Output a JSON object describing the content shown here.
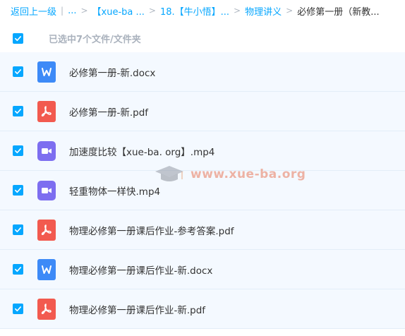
{
  "breadcrumb": {
    "back": "返回上一级",
    "sep1": "|",
    "ellipsis": "...",
    "arrow": ">",
    "crumb1": "【xue-ba ...",
    "crumb2": "18.【牛小悟】...",
    "crumb3": "物理讲义",
    "current": "必修第一册（新教..."
  },
  "selection": {
    "label": "已选中7个文件/文件夹"
  },
  "files": [
    {
      "name": "必修第一册-新.docx",
      "type": "word",
      "checked": true
    },
    {
      "name": "必修第一册-新.pdf",
      "type": "pdf",
      "checked": true
    },
    {
      "name": "加速度比较【xue-ba. org】.mp4",
      "type": "video",
      "checked": true
    },
    {
      "name": "轻重物体一样快.mp4",
      "type": "video",
      "checked": true
    },
    {
      "name": "物理必修第一册课后作业-参考答案.pdf",
      "type": "pdf",
      "checked": true
    },
    {
      "name": "物理必修第一册课后作业-新.docx",
      "type": "word",
      "checked": true
    },
    {
      "name": "物理必修第一册课后作业-新.pdf",
      "type": "pdf",
      "checked": true
    }
  ],
  "watermark": {
    "text": "www.xue-ba.org"
  },
  "colors": {
    "accent": "#06a7ff",
    "word": "#3d8af7",
    "pdf": "#f25a4f",
    "video": "#7d6ef0",
    "row_bg": "#f4f9ff"
  }
}
